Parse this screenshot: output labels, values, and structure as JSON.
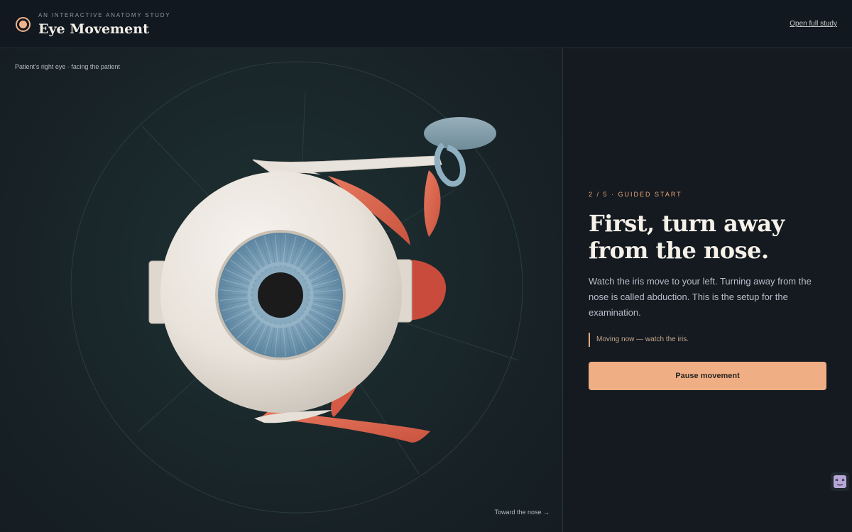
{
  "header": {
    "eyebrow": "AN INTERACTIVE ANATOMY STUDY",
    "title": "Eye Movement",
    "link_label": "Open full study",
    "logo_icon": "eye-logo-icon"
  },
  "viewer": {
    "caption": "Patient’s right eye · facing the patient",
    "direction_label": "Toward the nose →"
  },
  "step": {
    "meta": "2 / 5 · GUIDED START",
    "headline": "First, turn away from the nose.",
    "body": "Watch the iris move to your left. Turning away from the nose is called abduction. This is the setup for the examination.",
    "status": "Moving now — watch the iris.",
    "button_label": "Pause movement"
  },
  "floating": {
    "icon": "assistant-avatar-icon"
  },
  "colors": {
    "accent": "#f0ae85",
    "background": "#13191f",
    "sclera": "#ebe6e0",
    "iris": "#6f95ad",
    "muscle": "#d8644c",
    "tendon": "#e6e1da"
  }
}
